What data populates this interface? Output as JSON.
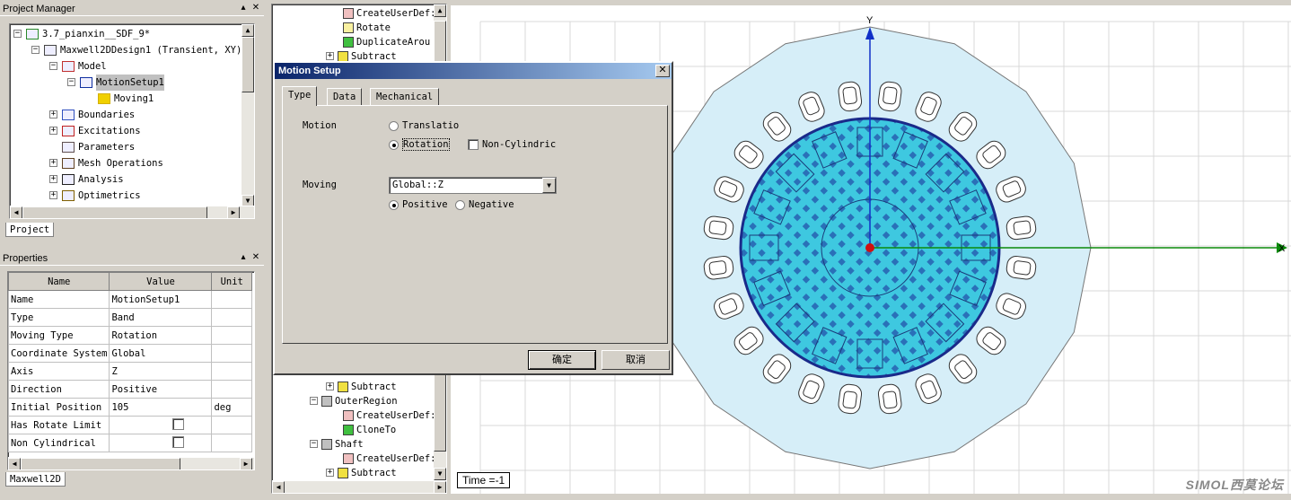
{
  "project_manager": {
    "title": "Project Manager",
    "tab": "Project",
    "tree": [
      {
        "label": "3.7_pianxin__SDF_9*",
        "icon": "project-icon"
      },
      {
        "label": "Maxwell2DDesign1 (Transient, XY)*",
        "icon": "design-icon"
      },
      {
        "label": "Model",
        "icon": "model-icon"
      },
      {
        "label": "MotionSetup1",
        "icon": "motion-setup-icon"
      },
      {
        "label": "Moving1",
        "icon": "moving-icon"
      },
      {
        "label": "Boundaries",
        "icon": "boundaries-icon"
      },
      {
        "label": "Excitations",
        "icon": "excitations-icon"
      },
      {
        "label": "Parameters",
        "icon": "parameters-icon"
      },
      {
        "label": "Mesh Operations",
        "icon": "mesh-icon"
      },
      {
        "label": "Analysis",
        "icon": "analysis-icon"
      },
      {
        "label": "Optimetrics",
        "icon": "optimetrics-icon"
      }
    ]
  },
  "properties": {
    "title": "Properties",
    "tab": "Maxwell2D",
    "headers": [
      "Name",
      "Value",
      "Unit"
    ],
    "rows": [
      {
        "name": "Name",
        "value": "MotionSetup1",
        "unit": ""
      },
      {
        "name": "Type",
        "value": "Band",
        "unit": ""
      },
      {
        "name": "Moving Type",
        "value": "Rotation",
        "unit": ""
      },
      {
        "name": "Coordinate System",
        "value": "Global",
        "unit": ""
      },
      {
        "name": "Axis",
        "value": "Z",
        "unit": ""
      },
      {
        "name": "Direction",
        "value": "Positive",
        "unit": ""
      },
      {
        "name": "Initial Position",
        "value": "105",
        "unit": "deg"
      },
      {
        "name": "Has Rotate Limit",
        "value": "",
        "unit": ""
      },
      {
        "name": "Non Cylindrical",
        "value": "",
        "unit": ""
      }
    ]
  },
  "history_tree": {
    "top": [
      "CreateUserDef:",
      "Rotate",
      "DuplicateArou",
      "Subtract"
    ],
    "bottom": [
      "Subtract",
      "OuterRegion",
      "CreateUserDef:",
      "CloneTo",
      "Shaft",
      "CreateUserDef:",
      "Subtract"
    ]
  },
  "dialog": {
    "title": "Motion Setup",
    "tabs": [
      "Type",
      "Data",
      "Mechanical"
    ],
    "motion_label": "Motion",
    "translation": "Translatio",
    "rotation": "Rotation",
    "non_cylindrical": "Non-Cylindric",
    "moving_label": "Moving",
    "moving_value": "Global::Z",
    "positive": "Positive",
    "negative": "Negative",
    "ok": "确定",
    "cancel": "取消"
  },
  "canvas": {
    "axis_x": "X",
    "axis_y": "Y",
    "time_label": "Time =-1",
    "watermark": "SIMOL西莫论坛"
  },
  "colors": {
    "outer_region": "#d6eef8",
    "rotor": "#3ec8e0",
    "rotor_edge": "#1a2a8a",
    "x_axis": "#0a8a0a",
    "y_axis": "#1030c8",
    "title_gradient": "#0a246a"
  }
}
